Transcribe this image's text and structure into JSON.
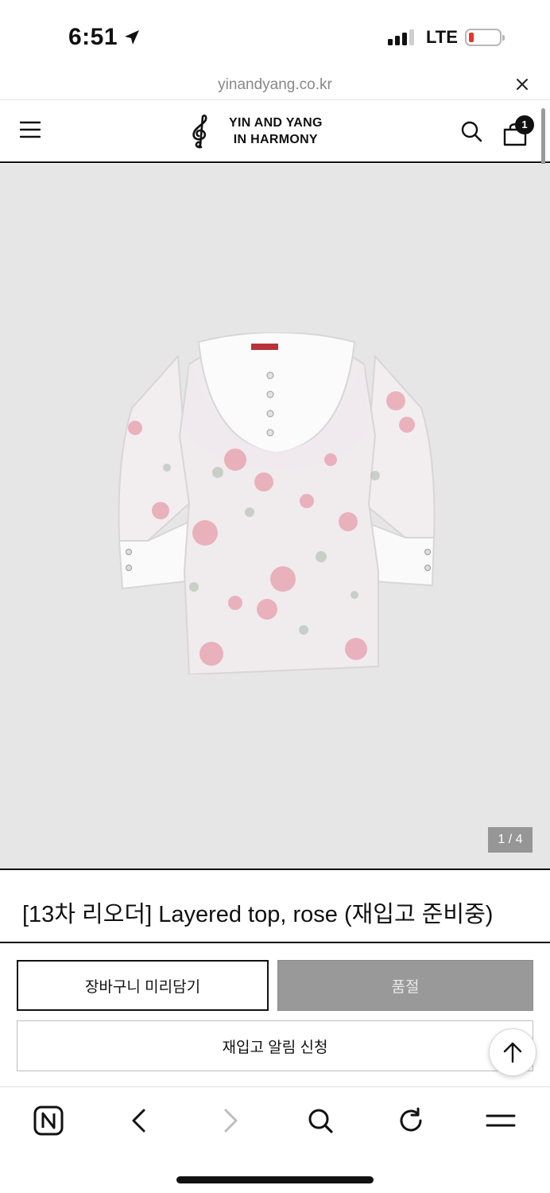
{
  "status_bar": {
    "time": "6:51",
    "network": "LTE",
    "icons": [
      "location-arrow-icon",
      "signal-icon",
      "battery-low-icon"
    ]
  },
  "browser": {
    "url": "yinandyang.co.kr"
  },
  "site_header": {
    "logo_line1": "YIN AND YANG",
    "logo_line2": "IN HARMONY",
    "cart_count": "1",
    "icons": [
      "menu-icon",
      "treble-clef-logo-icon",
      "search-icon",
      "shopping-bag-icon"
    ]
  },
  "gallery": {
    "counter": "1 / 4",
    "image": "floral-layered-top-photo"
  },
  "product": {
    "title": "[13차 리오더] Layered top, rose (재입고 준비중)"
  },
  "actions": {
    "cart_preview": "장바구니 미리담기",
    "sold_out": "품절",
    "restock_alert": "재입고 알림 신청"
  },
  "bottom_bar": {
    "icons": [
      "naver-home-icon",
      "back-icon",
      "forward-icon",
      "search-icon",
      "reload-icon",
      "menu-icon"
    ]
  },
  "colors": {
    "gallery_bg": "#e6e6e6",
    "sold_out_bg": "#999999",
    "battery_low": "#e5352c"
  }
}
